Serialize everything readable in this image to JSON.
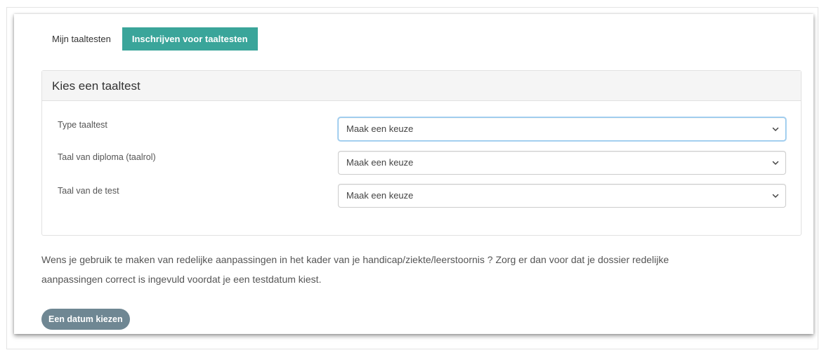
{
  "tabs": [
    {
      "label": "Mijn taaltesten",
      "active": false
    },
    {
      "label": "Inschrijven voor taaltesten",
      "active": true
    }
  ],
  "panel": {
    "title": "Kies een taaltest",
    "fields": [
      {
        "label": "Type taaltest",
        "value": "Maak een keuze"
      },
      {
        "label": "Taal van diploma (taalrol)",
        "value": "Maak een keuze"
      },
      {
        "label": "Taal van de test",
        "value": "Maak een keuze"
      }
    ]
  },
  "notice": {
    "line1": "Wens je gebruik te maken van redelijke aanpassingen in het kader van je handicap/ziekte/leerstoornis ? Zorg er dan voor dat je dossier redelijke",
    "line2": "aanpassingen correct is ingevuld voordat je een testdatum kiest."
  },
  "button": {
    "label": "Een datum kiezen"
  },
  "colors": {
    "accent_tab": "#3aa59a",
    "button_bg": "#6f8793",
    "panel_header_bg": "#f5f5f5",
    "focus_border": "#8ec4ea"
  }
}
